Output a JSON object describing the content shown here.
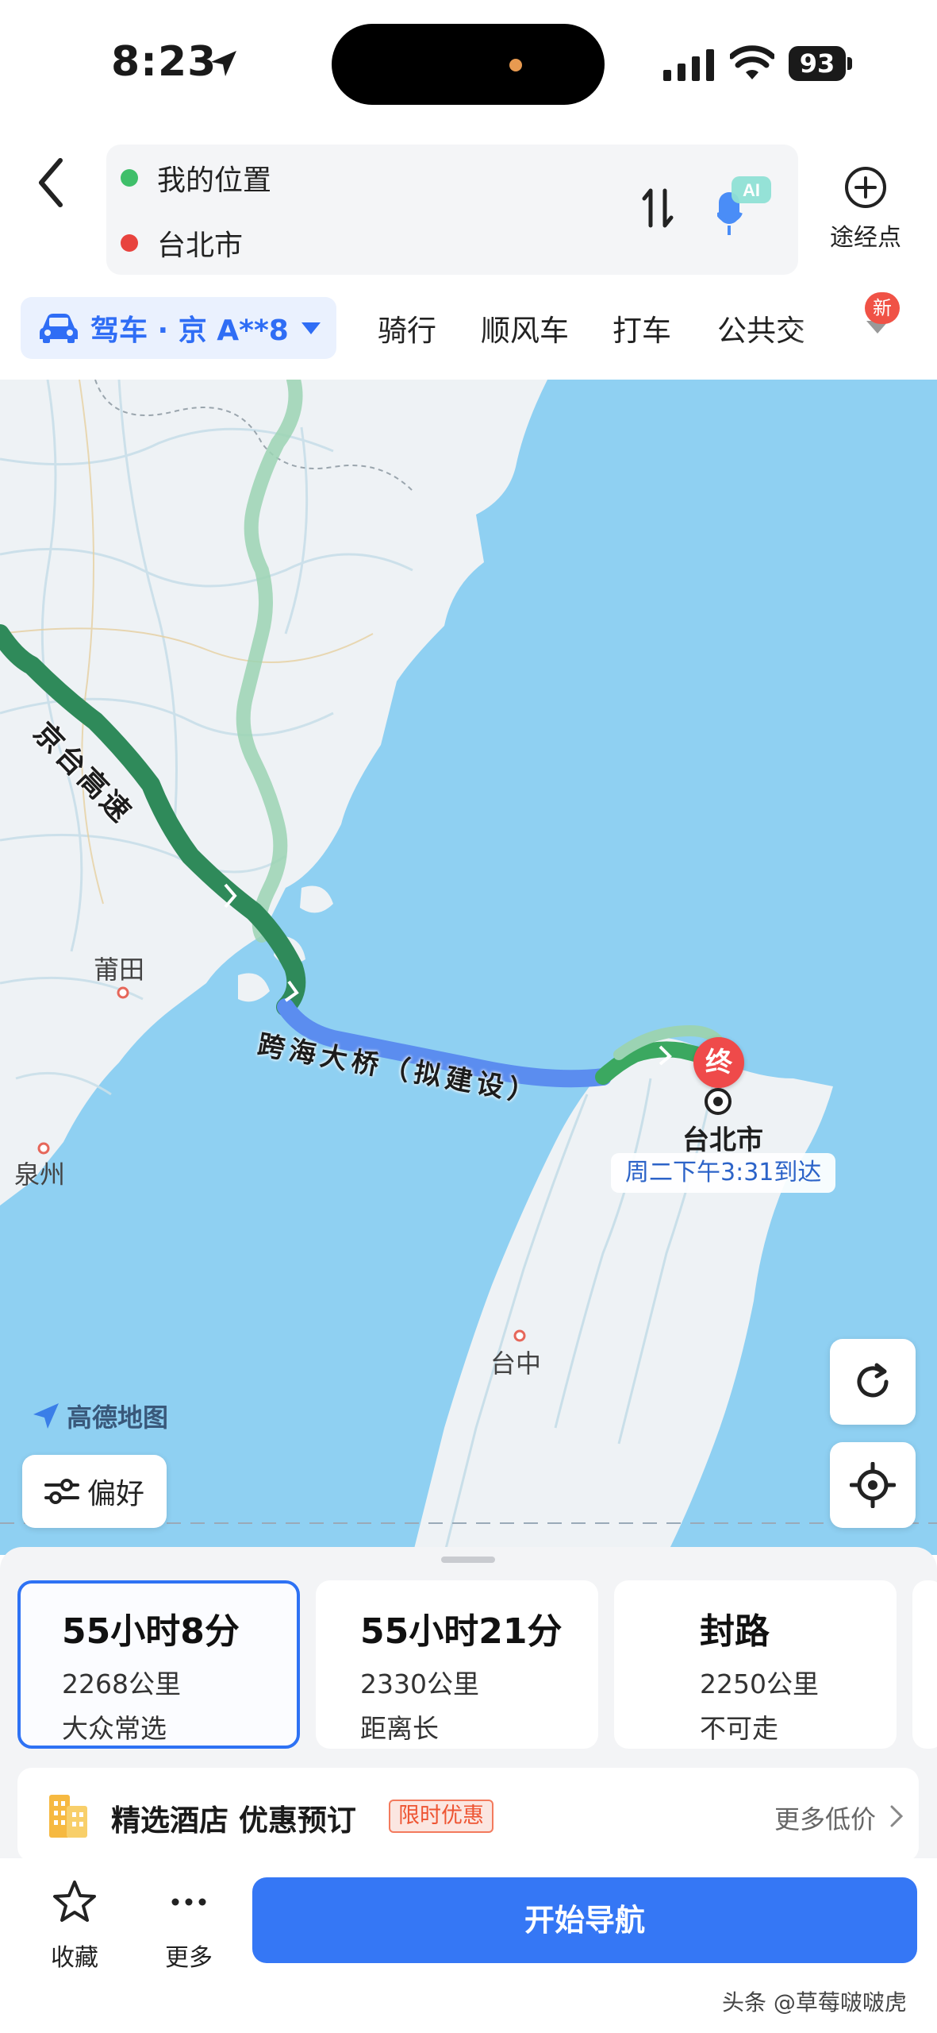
{
  "status_bar": {
    "time": "8:23",
    "battery": "93"
  },
  "header": {
    "origin": "我的位置",
    "destination": "台北市",
    "voice_badge": "AI",
    "waypoint_label": "途经点",
    "icons": {
      "back": "back-chevron-icon",
      "swap": "swap-icon",
      "voice": "voice-assistant-icon",
      "waypoint": "add-waypoint-icon"
    }
  },
  "modes": {
    "active": "驾车 · 京 A**8",
    "tabs": [
      "骑行",
      "顺风车",
      "打车",
      "公共交"
    ],
    "new_badge": "新"
  },
  "map": {
    "highway_label": "京台高速",
    "bridge_label": "跨海大桥（拟建设）",
    "cities": {
      "putian": "莆田",
      "quanzhou": "泉州",
      "taizhong": "台中",
      "taipei": "台北市"
    },
    "end_marker": "终",
    "arrival": "周二下午3:31到达",
    "brand": "高德地图",
    "preference": "偏好",
    "colors": {
      "sea": "#8fd0f2",
      "land": "#eef2f5",
      "route_primary": "#2f8a5a",
      "route_alt": "#82c9a0",
      "bridge": "#5b8def"
    }
  },
  "routes": [
    {
      "time": "55小时8分",
      "distance": "2268公里",
      "tag": "大众常选",
      "selected": true
    },
    {
      "time": "55小时21分",
      "distance": "2330公里",
      "tag": "距离长",
      "selected": false
    },
    {
      "time": "封路",
      "distance": "2250公里",
      "tag": "不可走",
      "selected": false
    }
  ],
  "promo": {
    "title": "精选酒店 优惠预订",
    "tag": "限时优惠",
    "more": "更多低价"
  },
  "actions": {
    "favorite": "收藏",
    "more": "更多",
    "start": "开始导航"
  },
  "watermark": "头条 @草莓啵啵虎"
}
